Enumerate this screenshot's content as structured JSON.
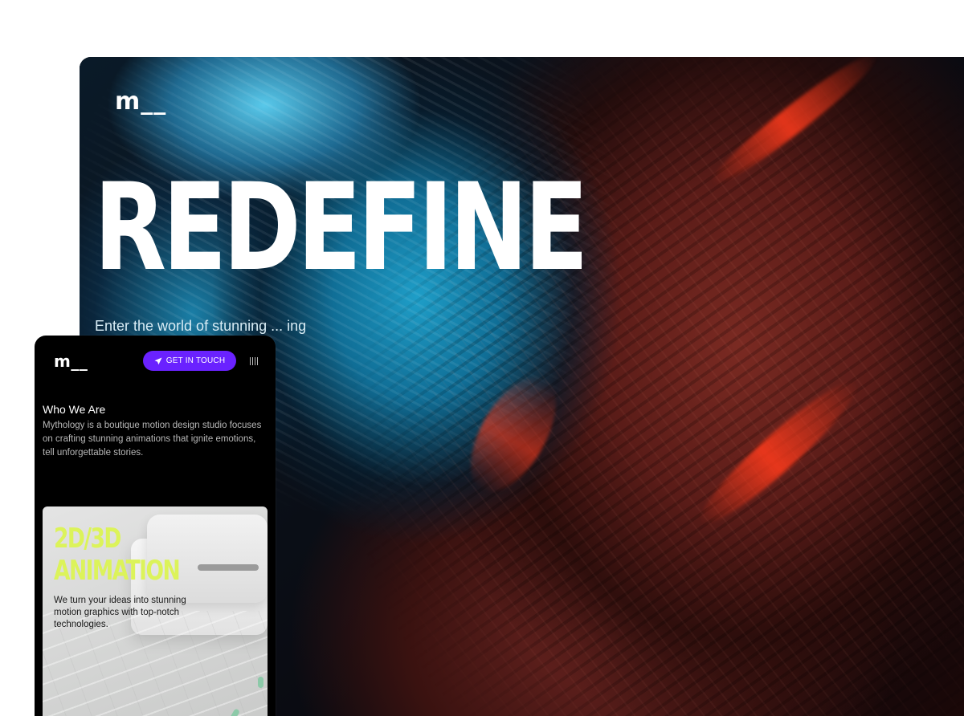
{
  "desktop": {
    "logo": "m__",
    "headline": "REDEFINE",
    "tagline": "Enter the world of stunning ... ing emotions."
  },
  "mobile": {
    "logo": "m__",
    "cta_label": "GET IN TOUCH",
    "cta_icon": "send-icon",
    "menu_icon": "menu-icon",
    "section_heading": "Who We Are",
    "section_body": "Mythology is a boutique motion design studio focuses on crafting stunning animations that ignite emotions, tell unforgettable stories.",
    "card": {
      "title_line1": "2D/3D",
      "title_line2": "ANIMATION",
      "description": "We turn your ideas into stunning motion graphics with top-notch technologies."
    }
  },
  "colors": {
    "cta_background": "#6a22ff",
    "card_title": "#dcf35a",
    "background": "#000000"
  }
}
